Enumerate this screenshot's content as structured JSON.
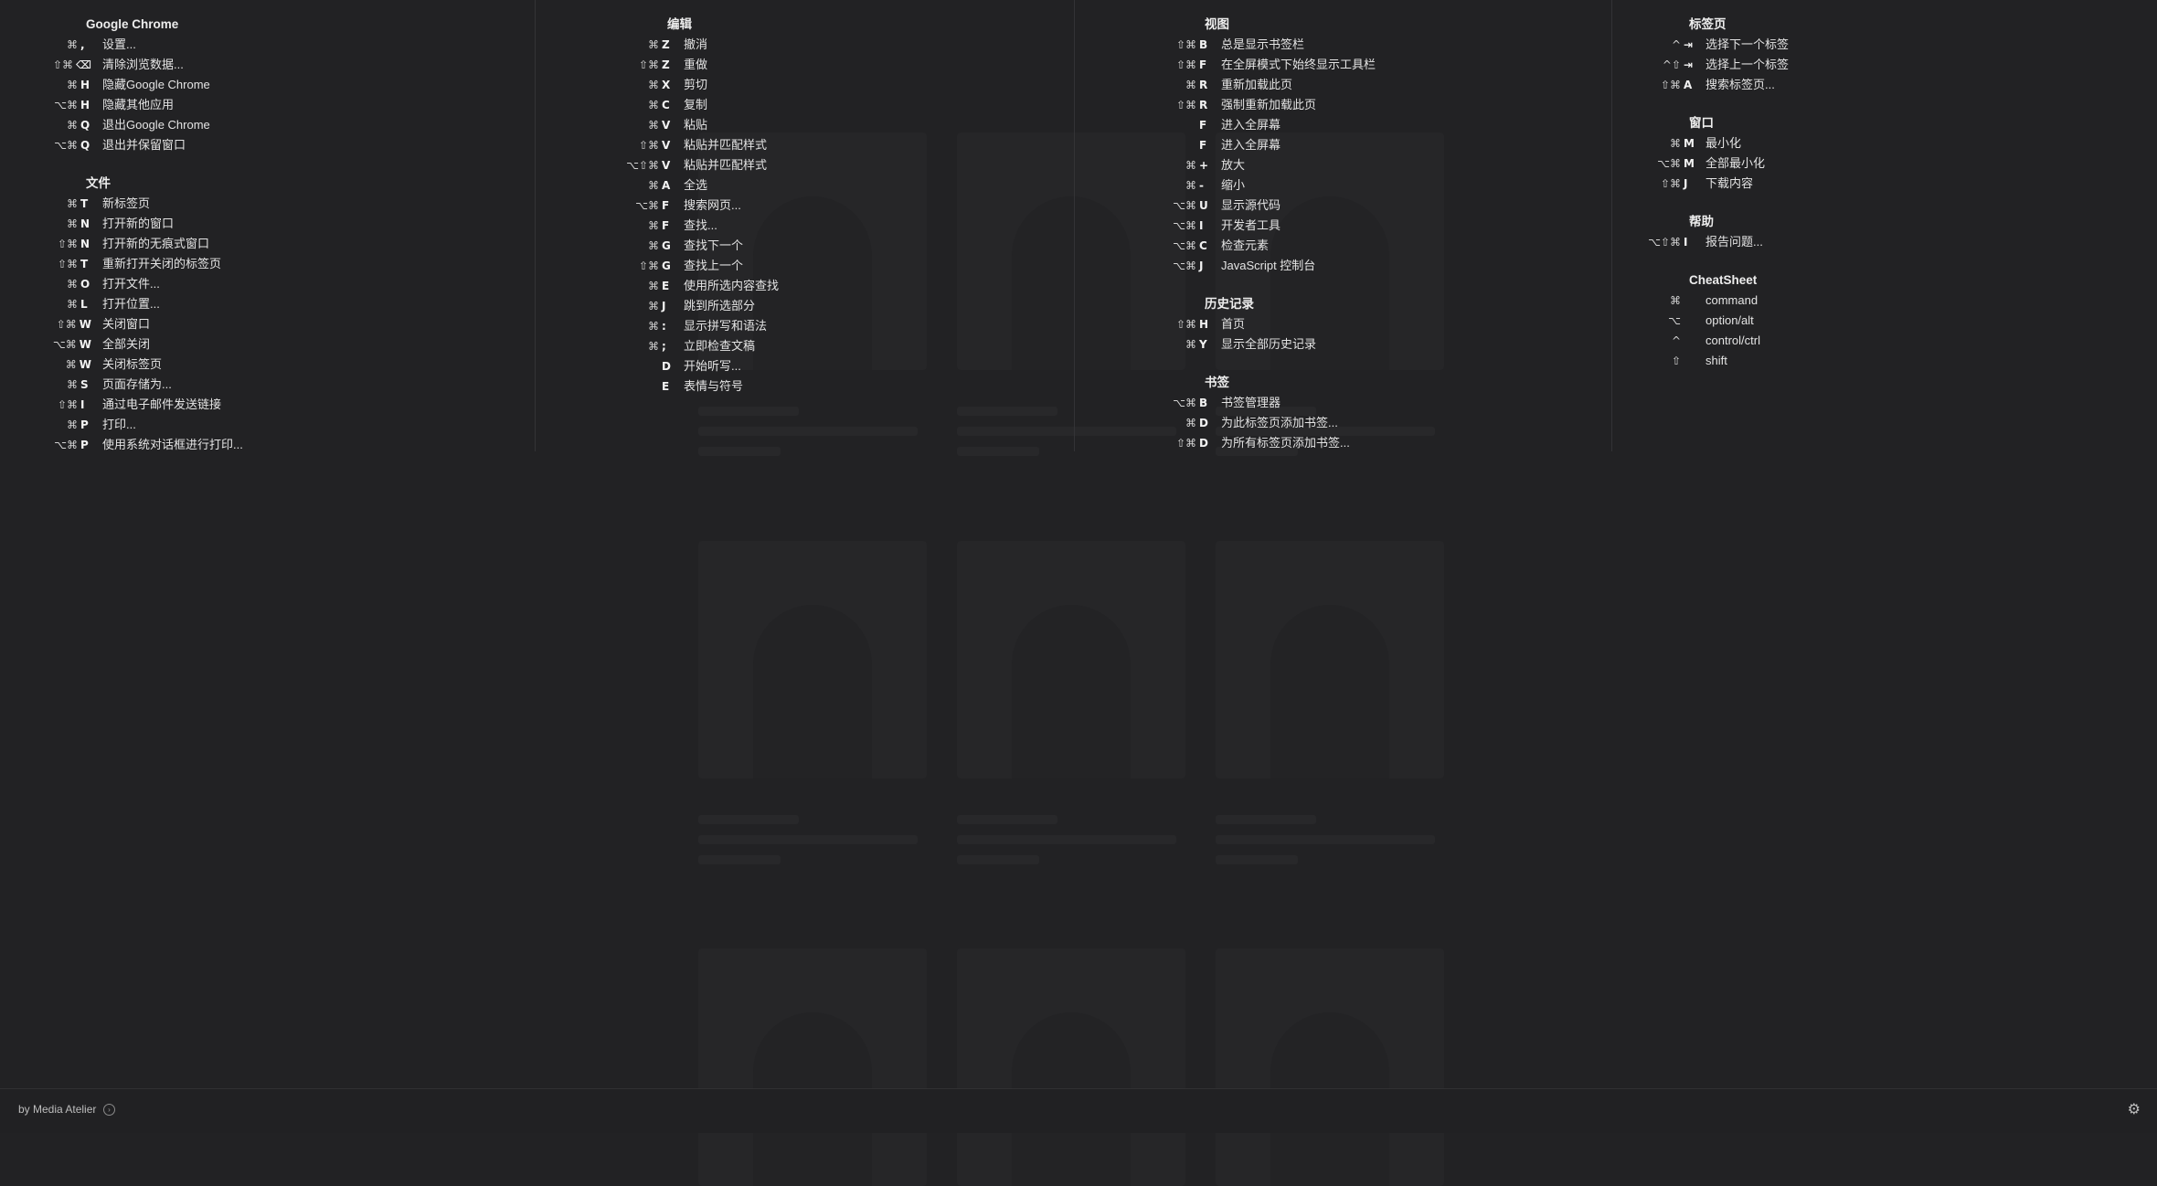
{
  "columns": [
    {
      "sections": [
        {
          "title": "Google Chrome",
          "items": [
            {
              "mods": "⌘",
              "key": ",",
              "label": "设置..."
            },
            {
              "mods": "⇧⌘",
              "key": "⌫",
              "label": "清除浏览数据..."
            },
            {
              "mods": "⌘",
              "key": "H",
              "label": "隐藏Google Chrome"
            },
            {
              "mods": "⌥⌘",
              "key": "H",
              "label": "隐藏其他应用"
            },
            {
              "mods": "⌘",
              "key": "Q",
              "label": "退出Google Chrome"
            },
            {
              "mods": "⌥⌘",
              "key": "Q",
              "label": "退出并保留窗口"
            }
          ]
        },
        {
          "title": "文件",
          "items": [
            {
              "mods": "⌘",
              "key": "T",
              "label": "新标签页"
            },
            {
              "mods": "⌘",
              "key": "N",
              "label": "打开新的窗口"
            },
            {
              "mods": "⇧⌘",
              "key": "N",
              "label": "打开新的无痕式窗口"
            },
            {
              "mods": "⇧⌘",
              "key": "T",
              "label": "重新打开关闭的标签页"
            },
            {
              "mods": "⌘",
              "key": "O",
              "label": "打开文件..."
            },
            {
              "mods": "⌘",
              "key": "L",
              "label": "打开位置..."
            },
            {
              "mods": "⇧⌘",
              "key": "W",
              "label": "关闭窗口"
            },
            {
              "mods": "⌥⌘",
              "key": "W",
              "label": "全部关闭"
            },
            {
              "mods": "⌘",
              "key": "W",
              "label": "关闭标签页"
            },
            {
              "mods": "⌘",
              "key": "S",
              "label": "页面存储为..."
            },
            {
              "mods": "⇧⌘",
              "key": "I",
              "label": "通过电子邮件发送链接"
            },
            {
              "mods": "⌘",
              "key": "P",
              "label": "打印..."
            },
            {
              "mods": "⌥⌘",
              "key": "P",
              "label": "使用系统对话框进行打印..."
            }
          ]
        }
      ]
    },
    {
      "sections": [
        {
          "title": "编辑",
          "items": [
            {
              "mods": "⌘",
              "key": "Z",
              "label": "撤消"
            },
            {
              "mods": "⇧⌘",
              "key": "Z",
              "label": "重做"
            },
            {
              "mods": "⌘",
              "key": "X",
              "label": "剪切"
            },
            {
              "mods": "⌘",
              "key": "C",
              "label": "复制"
            },
            {
              "mods": "⌘",
              "key": "V",
              "label": "粘贴"
            },
            {
              "mods": "⇧⌘",
              "key": "V",
              "label": "粘贴并匹配样式"
            },
            {
              "mods": "⌥⇧⌘",
              "key": "V",
              "label": "粘贴并匹配样式"
            },
            {
              "mods": "⌘",
              "key": "A",
              "label": "全选"
            },
            {
              "mods": "⌥⌘",
              "key": "F",
              "label": "搜索网页..."
            },
            {
              "mods": "⌘",
              "key": "F",
              "label": "查找..."
            },
            {
              "mods": "⌘",
              "key": "G",
              "label": "查找下一个"
            },
            {
              "mods": "⇧⌘",
              "key": "G",
              "label": "查找上一个"
            },
            {
              "mods": "⌘",
              "key": "E",
              "label": "使用所选内容查找"
            },
            {
              "mods": "⌘",
              "key": "J",
              "label": "跳到所选部分"
            },
            {
              "mods": "⌘",
              "key": ":",
              "label": "显示拼写和语法"
            },
            {
              "mods": "⌘",
              "key": ";",
              "label": "立即检查文稿"
            },
            {
              "mods": "",
              "key": "D",
              "label": "开始听写..."
            },
            {
              "mods": "",
              "key": "E",
              "label": "表情与符号"
            }
          ]
        }
      ]
    },
    {
      "sections": [
        {
          "title": "视图",
          "items": [
            {
              "mods": "⇧⌘",
              "key": "B",
              "label": "总是显示书签栏"
            },
            {
              "mods": "⇧⌘",
              "key": "F",
              "label": "在全屏模式下始终显示工具栏"
            },
            {
              "mods": "⌘",
              "key": "R",
              "label": "重新加载此页"
            },
            {
              "mods": "⇧⌘",
              "key": "R",
              "label": "强制重新加载此页"
            },
            {
              "mods": "",
              "key": "F",
              "label": "进入全屏幕"
            },
            {
              "mods": "",
              "key": "F",
              "label": "进入全屏幕"
            },
            {
              "mods": "⌘",
              "key": "+",
              "label": "放大"
            },
            {
              "mods": "⌘",
              "key": "-",
              "label": "缩小"
            },
            {
              "mods": "⌥⌘",
              "key": "U",
              "label": "显示源代码"
            },
            {
              "mods": "⌥⌘",
              "key": "I",
              "label": "开发者工具"
            },
            {
              "mods": "⌥⌘",
              "key": "C",
              "label": "检查元素"
            },
            {
              "mods": "⌥⌘",
              "key": "J",
              "label": "JavaScript 控制台"
            }
          ]
        },
        {
          "title": "历史记录",
          "items": [
            {
              "mods": "⇧⌘",
              "key": "H",
              "label": "首页"
            },
            {
              "mods": "⌘",
              "key": "Y",
              "label": "显示全部历史记录"
            }
          ]
        },
        {
          "title": "书签",
          "items": [
            {
              "mods": "⌥⌘",
              "key": "B",
              "label": "书签管理器"
            },
            {
              "mods": "⌘",
              "key": "D",
              "label": "为此标签页添加书签..."
            },
            {
              "mods": "⇧⌘",
              "key": "D",
              "label": "为所有标签页添加书签..."
            }
          ]
        }
      ]
    },
    {
      "sections": [
        {
          "title": "标签页",
          "items": [
            {
              "mods": "^",
              "key": "⇥",
              "label": "选择下一个标签"
            },
            {
              "mods": "^⇧",
              "key": "⇥",
              "label": "选择上一个标签"
            },
            {
              "mods": "⇧⌘",
              "key": "A",
              "label": "搜索标签页..."
            }
          ]
        },
        {
          "title": "窗口",
          "items": [
            {
              "mods": "⌘",
              "key": "M",
              "label": "最小化"
            },
            {
              "mods": "⌥⌘",
              "key": "M",
              "label": "全部最小化"
            },
            {
              "mods": "⇧⌘",
              "key": "J",
              "label": "下载内容"
            }
          ]
        },
        {
          "title": "帮助",
          "items": [
            {
              "mods": "⌥⇧⌘",
              "key": "I",
              "label": "报告问题..."
            }
          ]
        },
        {
          "title": "CheatSheet",
          "items": [
            {
              "mods": "⌘",
              "key": "",
              "label": "command"
            },
            {
              "mods": "⌥",
              "key": "",
              "label": "option/alt"
            },
            {
              "mods": "^",
              "key": "",
              "label": "control/ctrl"
            },
            {
              "mods": "⇧",
              "key": "",
              "label": "shift"
            }
          ]
        }
      ]
    }
  ],
  "footer": {
    "by_label": "by Media Atelier",
    "link_icon": "arrow-circle-icon",
    "settings_icon": "gear-icon",
    "link_glyph": "›",
    "settings_glyph": "⚙"
  }
}
